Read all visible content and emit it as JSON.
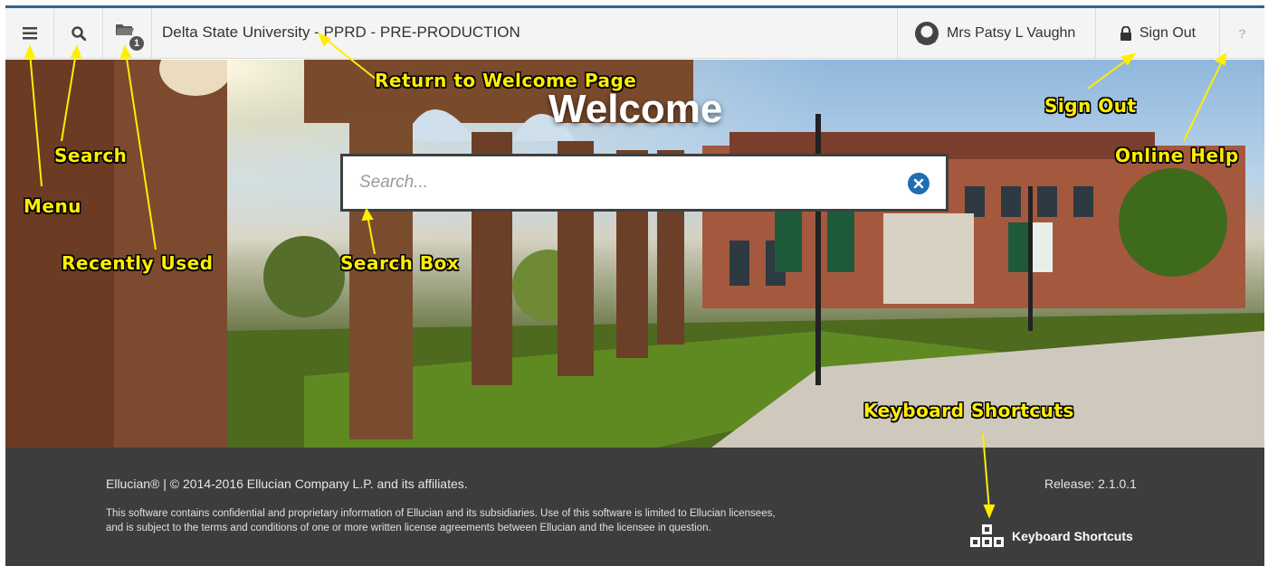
{
  "header": {
    "menu_icon": "hamburger-menu-icon",
    "search_icon": "search-icon",
    "recent_icon": "folder-icon",
    "recent_badge": "1",
    "app_title": "Delta State University - PPRD - PRE-PRODUCTION",
    "user_name": "Mrs Patsy L Vaughn",
    "sign_out_label": "Sign Out",
    "help_label": "?"
  },
  "hero": {
    "welcome": "Welcome",
    "search_placeholder": "Search...",
    "search_value": ""
  },
  "annotations": {
    "return_welcome": "Return to Welcome Page",
    "search": "Search",
    "menu": "Menu",
    "recently_used": "Recently Used",
    "search_box": "Search Box",
    "sign_out": "Sign Out",
    "online_help": "Online Help",
    "keyboard_shortcuts": "Keyboard Shortcuts"
  },
  "footer": {
    "copyright": "Ellucian® | © 2014-2016 Ellucian Company L.P. and its affiliates.",
    "legal": "This software contains confidential and proprietary information of Ellucian and its subsidiaries. Use of this software is limited to Ellucian licensees, and is subject to the terms and conditions of one or more written license agreements between Ellucian and the licensee in question.",
    "release": "Release: 2.1.0.1",
    "keyboard_shortcuts": "Keyboard Shortcuts"
  },
  "colors": {
    "accent": "#2a6496",
    "annotation": "#ffee00",
    "footer_bg": "#3d3d3d",
    "clear_button": "#1f6fb2"
  }
}
